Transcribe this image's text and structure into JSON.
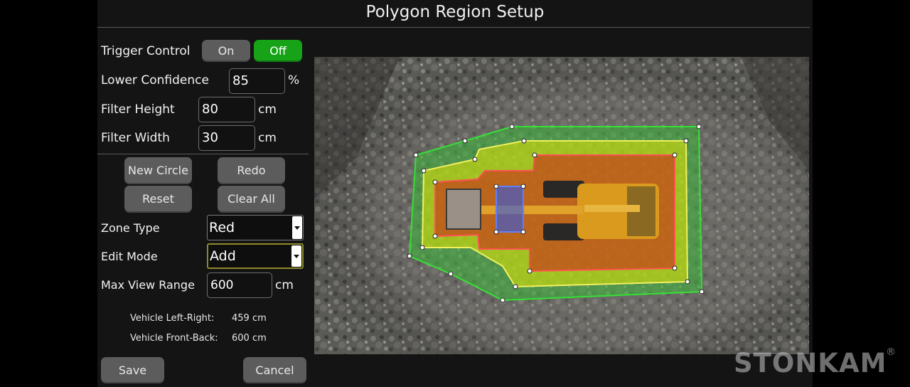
{
  "app_title": "Polygon Region Setup",
  "trigger_control": {
    "label": "Trigger Control",
    "on_label": "On",
    "off_label": "Off",
    "selected": "Off"
  },
  "lower_confidence": {
    "label": "Lower Confidence",
    "value": "85",
    "unit": "%"
  },
  "filter_height": {
    "label": "Filter Height",
    "value": "80",
    "unit": "cm"
  },
  "filter_width": {
    "label": "Filter Width",
    "value": "30",
    "unit": "cm"
  },
  "actions": {
    "new_circle": "New Circle",
    "redo": "Redo",
    "reset": "Reset",
    "clear_all": "Clear All"
  },
  "zone_type": {
    "label": "Zone Type",
    "value": "Red"
  },
  "edit_mode": {
    "label": "Edit Mode",
    "value": "Add"
  },
  "max_view_range": {
    "label": "Max View Range",
    "value": "600",
    "unit": "cm"
  },
  "vehicle_info": {
    "left_right_label": "Vehicle Left-Right:",
    "left_right_value": "459 cm",
    "front_back_label": "Vehicle Front-Back:",
    "front_back_value": "600 cm"
  },
  "footer": {
    "save_label": "Save",
    "cancel_label": "Cancel"
  },
  "brand": {
    "name": "STONKAM",
    "mark": "®"
  },
  "colors": {
    "active_green": "#17a317",
    "button_gray": "#5c5c5c",
    "zone_green": "#2fc82f",
    "zone_yellow": "#e6e600",
    "zone_red": "#d01818",
    "zone_blue": "#3a5bd8"
  }
}
